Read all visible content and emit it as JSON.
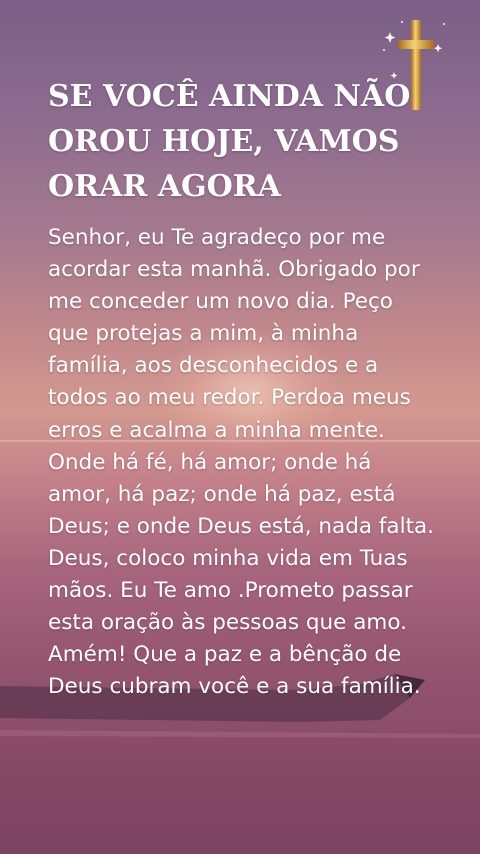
{
  "title": "SE VOCÊ AINDA NÃO OROU HOJE, VAMOS ORAR AGORA",
  "prayer": "Senhor, eu Te agradeço por me acordar esta manhã. Obrigado por me conceder um novo dia. Peço que protejas a mim, à minha família, aos desconhecidos e a todos ao meu redor. Perdoa meus erros e acalma a minha mente. Onde há fé, há amor; onde há amor, há paz; onde há paz, está Deus; e onde Deus está, nada falta. Deus, coloco minha vida em Tuas mãos. Eu Te amo .Prometo passar esta oração às pessoas que amo. Amém! Que a paz e a bênção de Deus cubram você e a sua família.",
  "icons": {
    "cross": "golden-cross-icon",
    "sparkles": "sparkle-icon"
  },
  "colors": {
    "cross_gold": "#d9a441",
    "text": "#ffffff"
  }
}
